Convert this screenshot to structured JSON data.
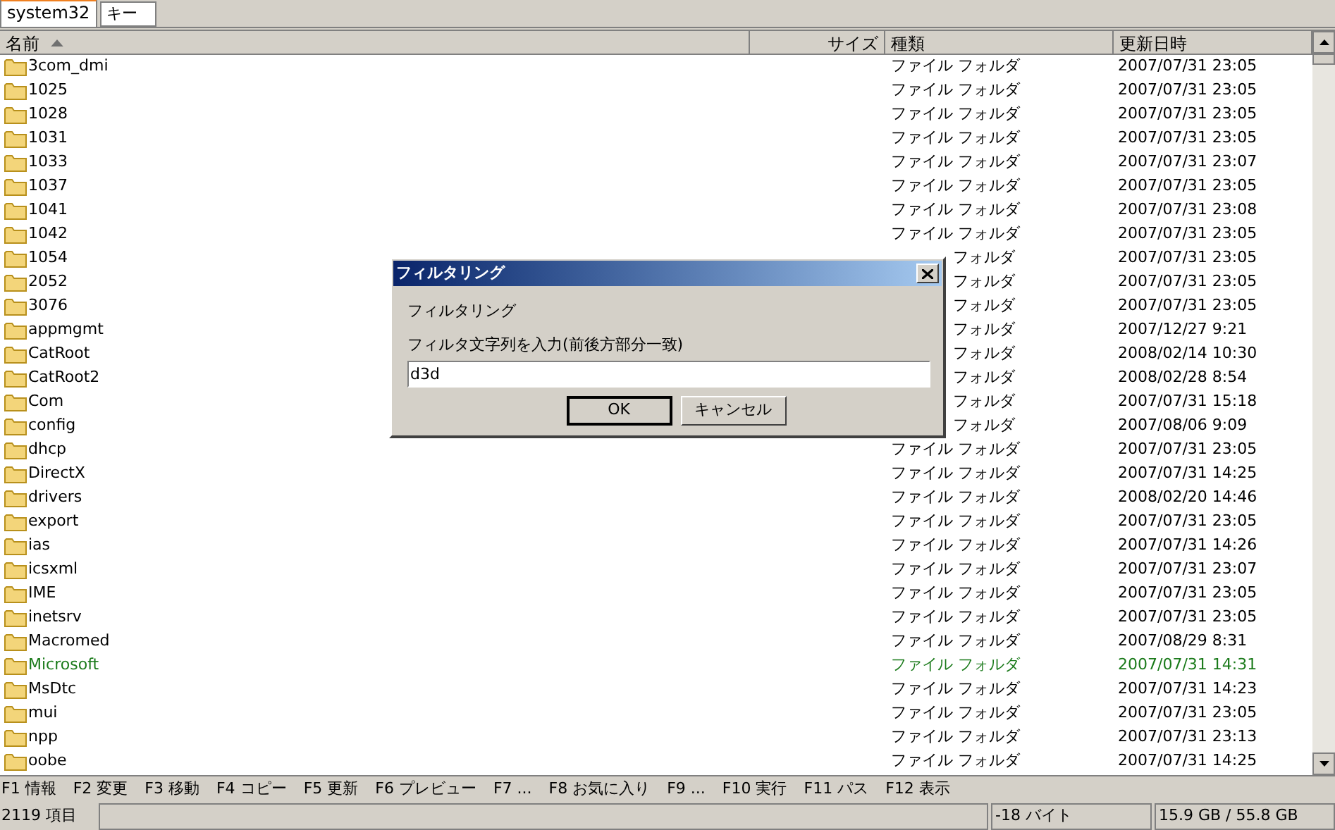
{
  "tabs": [
    {
      "label": "system32",
      "selected": true
    },
    {
      "label": "キー",
      "selected": false
    }
  ],
  "table": {
    "columns": [
      {
        "label": "名前",
        "sorted": true
      },
      {
        "label": "サイズ",
        "sorted": false
      },
      {
        "label": "種類",
        "sorted": false
      },
      {
        "label": "更新日時",
        "sorted": false
      }
    ],
    "rows": [
      {
        "name": "3com_dmi",
        "type": "ファイル フォルダ",
        "date": "2007/07/31 23:05",
        "color": "#000000"
      },
      {
        "name": "1025",
        "type": "ファイル フォルダ",
        "date": "2007/07/31 23:05",
        "color": "#000000"
      },
      {
        "name": "1028",
        "type": "ファイル フォルダ",
        "date": "2007/07/31 23:05",
        "color": "#000000"
      },
      {
        "name": "1031",
        "type": "ファイル フォルダ",
        "date": "2007/07/31 23:05",
        "color": "#000000"
      },
      {
        "name": "1033",
        "type": "ファイル フォルダ",
        "date": "2007/07/31 23:07",
        "color": "#000000"
      },
      {
        "name": "1037",
        "type": "ファイル フォルダ",
        "date": "2007/07/31 23:05",
        "color": "#000000"
      },
      {
        "name": "1041",
        "type": "ファイル フォルダ",
        "date": "2007/07/31 23:08",
        "color": "#000000"
      },
      {
        "name": "1042",
        "type": "ファイル フォルダ",
        "date": "2007/07/31 23:05",
        "color": "#000000"
      },
      {
        "name": "1054",
        "type": "フォルダ",
        "type_clipped": true,
        "date": "2007/07/31 23:05",
        "color": "#000000"
      },
      {
        "name": "2052",
        "type": "フォルダ",
        "type_clipped": true,
        "date": "2007/07/31 23:05",
        "color": "#000000"
      },
      {
        "name": "3076",
        "type": "フォルダ",
        "type_clipped": true,
        "date": "2007/07/31 23:05",
        "color": "#000000"
      },
      {
        "name": "appmgmt",
        "type": "フォルダ",
        "type_clipped": true,
        "date": "2007/12/27 9:21",
        "color": "#000000"
      },
      {
        "name": "CatRoot",
        "type": "フォルダ",
        "type_clipped": true,
        "date": "2008/02/14 10:30",
        "color": "#000000"
      },
      {
        "name": "CatRoot2",
        "type": "フォルダ",
        "type_clipped": true,
        "date": "2008/02/28 8:54",
        "color": "#000000"
      },
      {
        "name": "Com",
        "type": "フォルダ",
        "type_clipped": true,
        "date": "2007/07/31 15:18",
        "color": "#000000"
      },
      {
        "name": "config",
        "type": "フォルダ",
        "type_clipped": true,
        "date": "2007/08/06 9:09",
        "color": "#000000"
      },
      {
        "name": "dhcp",
        "type": "ファイル フォルダ",
        "date": "2007/07/31 23:05",
        "color": "#000000"
      },
      {
        "name": "DirectX",
        "type": "ファイル フォルダ",
        "date": "2007/07/31 14:25",
        "color": "#000000"
      },
      {
        "name": "drivers",
        "type": "ファイル フォルダ",
        "date": "2008/02/20 14:46",
        "color": "#000000"
      },
      {
        "name": "export",
        "type": "ファイル フォルダ",
        "date": "2007/07/31 23:05",
        "color": "#000000"
      },
      {
        "name": "ias",
        "type": "ファイル フォルダ",
        "date": "2007/07/31 14:26",
        "color": "#000000"
      },
      {
        "name": "icsxml",
        "type": "ファイル フォルダ",
        "date": "2007/07/31 23:07",
        "color": "#000000"
      },
      {
        "name": "IME",
        "type": "ファイル フォルダ",
        "date": "2007/07/31 23:05",
        "color": "#000000"
      },
      {
        "name": "inetsrv",
        "type": "ファイル フォルダ",
        "date": "2007/07/31 23:05",
        "color": "#000000"
      },
      {
        "name": "Macromed",
        "type": "ファイル フォルダ",
        "date": "2007/08/29 8:31",
        "color": "#000000"
      },
      {
        "name": "Microsoft",
        "type": "ファイル フォルダ",
        "date": "2007/07/31 14:31",
        "color": "#1a7a1a"
      },
      {
        "name": "MsDtc",
        "type": "ファイル フォルダ",
        "date": "2007/07/31 14:23",
        "color": "#000000"
      },
      {
        "name": "mui",
        "type": "ファイル フォルダ",
        "date": "2007/07/31 23:05",
        "color": "#000000"
      },
      {
        "name": "npp",
        "type": "ファイル フォルダ",
        "date": "2007/07/31 23:13",
        "color": "#000000"
      },
      {
        "name": "oobe",
        "type": "ファイル フォルダ",
        "date": "2007/07/31 14:25",
        "color": "#000000"
      }
    ]
  },
  "function_keys": [
    "F1 情報",
    "F2 変更",
    "F3 移動",
    "F4 コピー",
    "F5 更新",
    "F6 プレビュー",
    "F7 ...",
    "F8 お気に入り",
    "F9 ...",
    "F10 実行",
    "F11 パス",
    "F12 表示"
  ],
  "status_bar": {
    "count": "2119 項目",
    "size": "-18 バイト",
    "disk": "15.9 GB / 55.8 GB"
  },
  "dialog": {
    "title": "フィルタリング",
    "heading": "フィルタリング",
    "label": "フィルタ文字列を入力(前後方部分一致)",
    "value": "d3d",
    "buttons": [
      {
        "label": "OK",
        "default": true
      },
      {
        "label": "キャンセル",
        "default": false
      }
    ]
  }
}
